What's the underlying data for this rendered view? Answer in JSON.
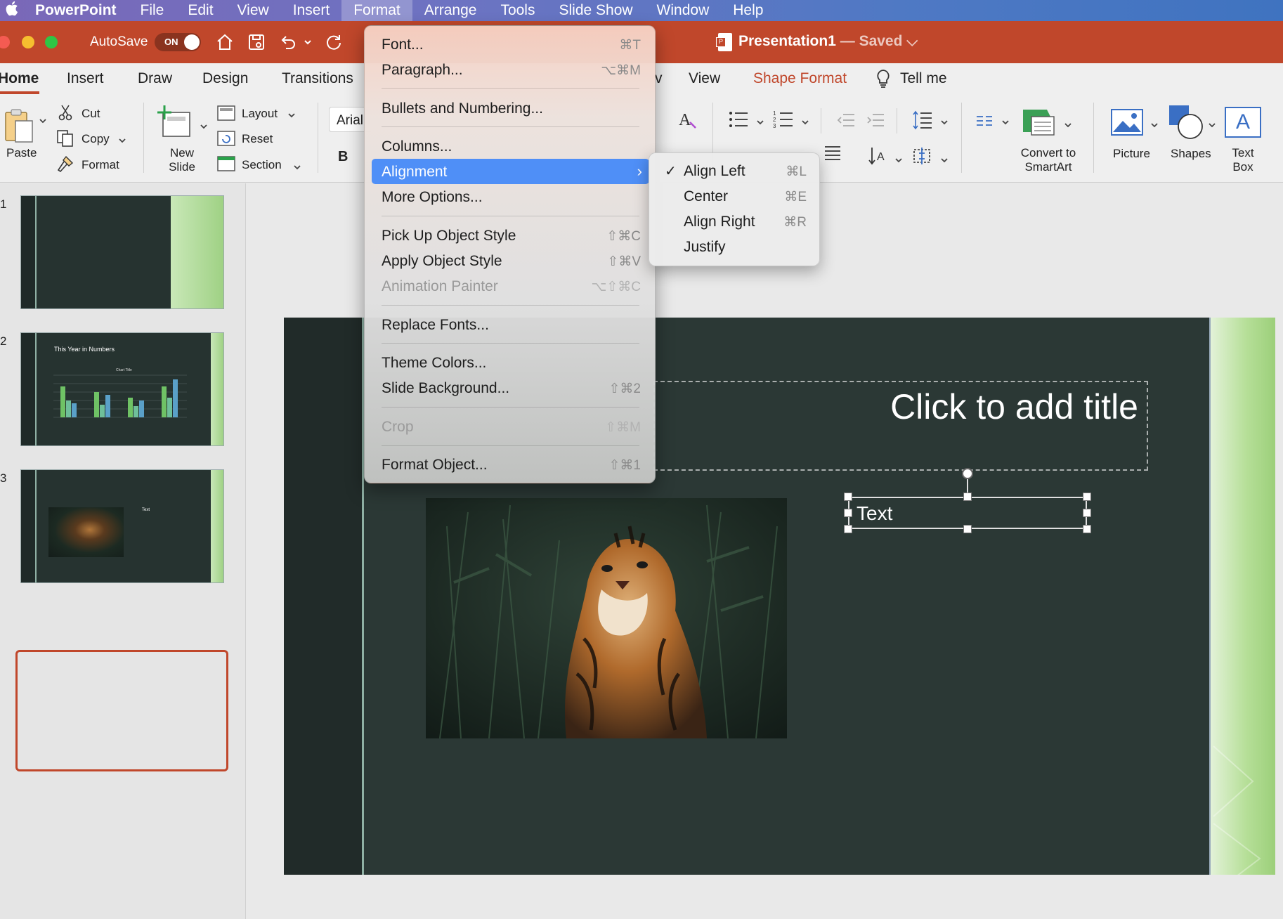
{
  "menubar": {
    "apple": "",
    "app_name": "PowerPoint",
    "items": [
      "File",
      "Edit",
      "View",
      "Insert",
      "Format",
      "Arrange",
      "Tools",
      "Slide Show",
      "Window",
      "Help"
    ],
    "active_item": "Format"
  },
  "titlebar": {
    "autosave_label": "AutoSave",
    "autosave_toggle": "ON",
    "doc_name": "Presentation1",
    "doc_status": "— Saved",
    "status_chevron": "⌵"
  },
  "tabs": {
    "home": "Home",
    "insert": "Insert",
    "draw": "Draw",
    "design": "Design",
    "transitions": "Transitions",
    "view_partial": "v",
    "view": "View",
    "shape_format": "Shape Format",
    "tell_me": "Tell me"
  },
  "ribbon": {
    "paste": "Paste",
    "cut": "Cut",
    "copy": "Copy",
    "format": "Format",
    "new_slide_line1": "New",
    "new_slide_line2": "Slide",
    "layout": "Layout",
    "reset": "Reset",
    "section": "Section",
    "font_name": "Arial",
    "bold": "B",
    "convert_line1": "Convert to",
    "convert_line2": "SmartArt",
    "picture": "Picture",
    "shapes": "Shapes",
    "textbox_line1": "Text",
    "textbox_line2": "Box",
    "textbox_glyph": "A"
  },
  "thumbnails": {
    "slide1_num": "1",
    "slide2_num": "2",
    "slide3_num": "3",
    "slide2_title": "This Year in Numbers",
    "slide2_chart_title": "Chart Title",
    "slide3_text": "Text"
  },
  "format_menu": {
    "items": [
      {
        "label": "Font...",
        "shortcut": "⌘T"
      },
      {
        "label": "Paragraph...",
        "shortcut": "⌥⌘M"
      },
      {
        "label": "Bullets and Numbering...",
        "shortcut": ""
      },
      {
        "label": "Columns...",
        "shortcut": ""
      },
      {
        "label": "Alignment",
        "shortcut": "›"
      },
      {
        "label": "More Options...",
        "shortcut": ""
      },
      {
        "label": "Pick Up Object Style",
        "shortcut": "⇧⌘C"
      },
      {
        "label": "Apply Object Style",
        "shortcut": "⇧⌘V"
      },
      {
        "label": "Animation Painter",
        "shortcut": "⌥⇧⌘C"
      },
      {
        "label": "Replace Fonts...",
        "shortcut": ""
      },
      {
        "label": "Theme Colors...",
        "shortcut": ""
      },
      {
        "label": "Slide Background...",
        "shortcut": "⇧⌘2"
      },
      {
        "label": "Crop",
        "shortcut": "⇧⌘M"
      },
      {
        "label": "Format Object...",
        "shortcut": "⇧⌘1"
      }
    ]
  },
  "alignment_submenu": {
    "items": [
      {
        "label": "Align Left",
        "shortcut": "⌘L",
        "checked": "✓"
      },
      {
        "label": "Center",
        "shortcut": "⌘E",
        "checked": ""
      },
      {
        "label": "Align Right",
        "shortcut": "⌘R",
        "checked": ""
      },
      {
        "label": "Justify",
        "shortcut": "",
        "checked": ""
      }
    ]
  },
  "slide": {
    "title_placeholder": "Click to add title",
    "text_box": "Text"
  },
  "colors": {
    "accent": "#c0472b",
    "menu_highlight": "#4f8ff7",
    "slide_background": "#2b3835"
  }
}
